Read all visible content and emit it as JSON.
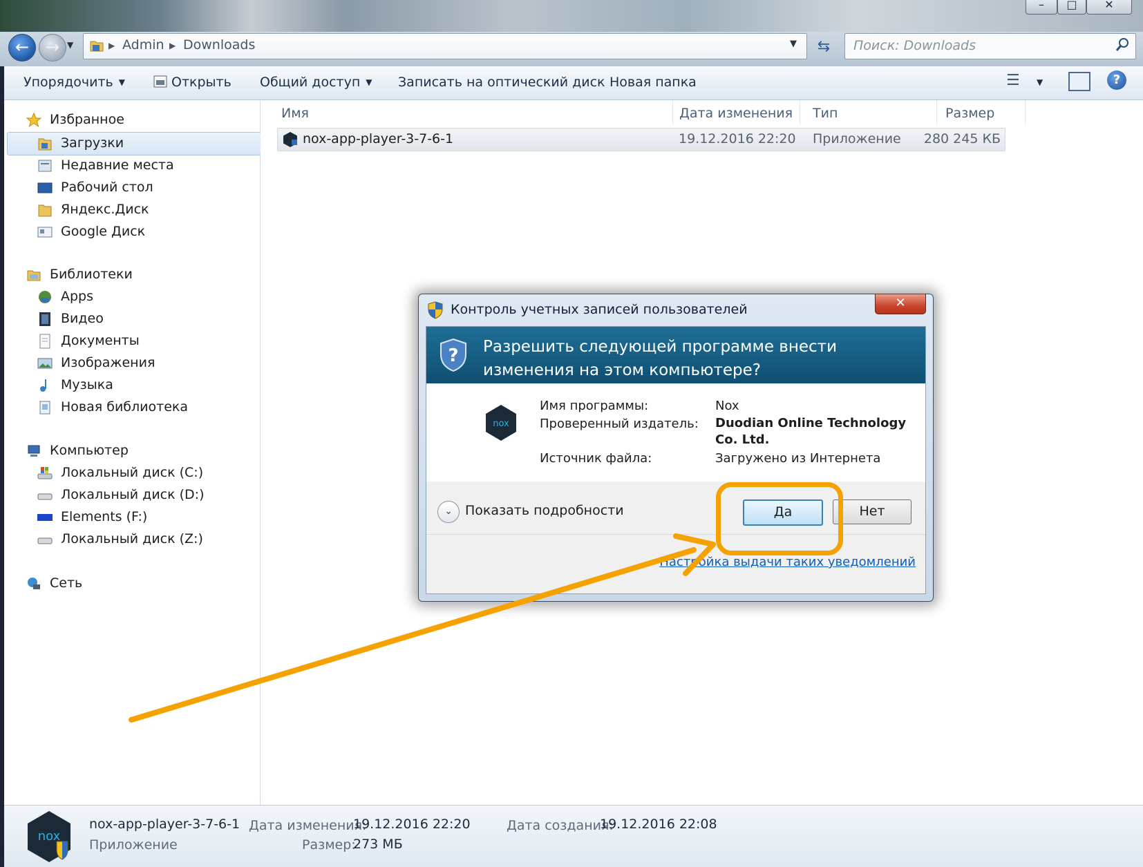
{
  "window": {
    "controls": [
      "–",
      "□",
      "✕"
    ]
  },
  "address_bar": {
    "breadcrumb": [
      "Admin",
      "Downloads"
    ],
    "search_placeholder": "Поиск: Downloads"
  },
  "toolbar": {
    "organize": "Упорядочить",
    "open": "Открыть",
    "share": "Общий доступ",
    "burn": "Записать на оптический диск",
    "new_folder": "Новая папка"
  },
  "sidebar": {
    "favorites": {
      "label": "Избранное",
      "items": [
        "Загрузки",
        "Недавние места",
        "Рабочий стол",
        "Яндекс.Диск",
        "Google Диск"
      ]
    },
    "libraries": {
      "label": "Библиотеки",
      "items": [
        "Apps",
        "Видео",
        "Документы",
        "Изображения",
        "Музыка",
        "Новая библиотека"
      ]
    },
    "computer": {
      "label": "Компьютер",
      "items": [
        "Локальный диск (C:)",
        "Локальный диск (D:)",
        "Elements (F:)",
        "Локальный диск (Z:)"
      ]
    },
    "network": {
      "label": "Сеть"
    }
  },
  "file_list": {
    "columns": [
      "Имя",
      "Дата изменения",
      "Тип",
      "Размер"
    ],
    "rows": [
      {
        "name": "nox-app-player-3-7-6-1",
        "modified": "19.12.2016 22:20",
        "type": "Приложение",
        "size": "280 245 КБ"
      }
    ]
  },
  "details": {
    "name": "nox-app-player-3-7-6-1",
    "type": "Приложение",
    "modified_label": "Дата изменения:",
    "modified": "19.12.2016 22:20",
    "created_label": "Дата создания:",
    "created": "19.12.2016 22:08",
    "size_label": "Размер:",
    "size": "273 МБ"
  },
  "uac": {
    "title": "Контроль учетных записей пользователей",
    "question": "Разрешить следующей программе внести изменения на этом компьютере?",
    "program_label": "Имя программы:",
    "program": "Nox",
    "publisher_label": "Проверенный издатель:",
    "publisher": "Duodian Online Technology Co. Ltd.",
    "source_label": "Источник файла:",
    "source": "Загружено из Интернета",
    "show_details": "Показать подробности",
    "yes": "Да",
    "no": "Нет",
    "settings_link": "Настройка выдачи таких уведомлений"
  },
  "colors": {
    "annotation": "#f5a100",
    "uac_header": "#1a628a",
    "link": "#0c5fbd"
  }
}
